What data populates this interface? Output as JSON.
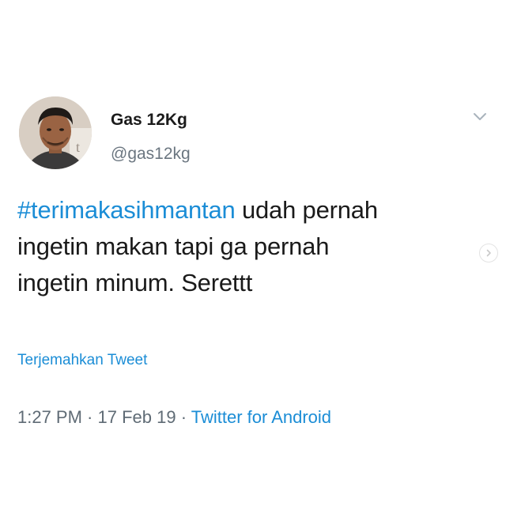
{
  "author": {
    "display_name": "Gas 12Kg",
    "handle": "@gas12kg"
  },
  "tweet": {
    "hashtag": "#terimakasihmantan",
    "text_line1_rest": " udah pernah",
    "text_line2": "ingetin makan tapi ga pernah",
    "text_line3": "ingetin minum. Serettt"
  },
  "translate_label": "Terjemahkan Tweet",
  "meta": {
    "time": "1:27 PM",
    "separator": " · ",
    "date": "17 Feb 19",
    "source": "Twitter for Android"
  },
  "icons": {
    "menu": "chevron-down-icon",
    "next": "chevron-right-icon"
  },
  "colors": {
    "link": "#1b8dd6",
    "text": "#1a1a1a",
    "muted": "#5f6b75"
  }
}
